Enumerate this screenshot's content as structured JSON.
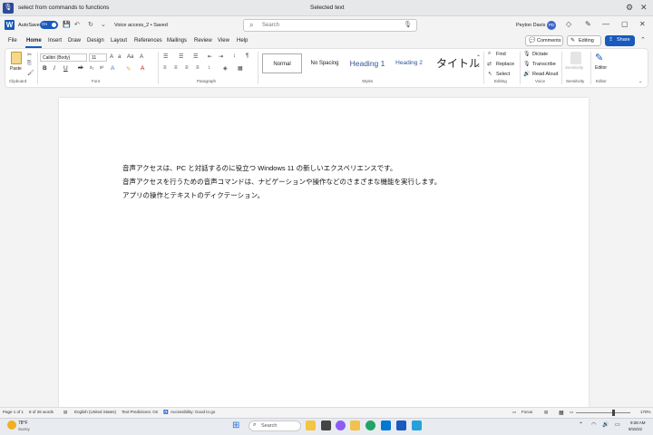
{
  "voice_access": {
    "command_text": "select from commands to functions",
    "title": "Selected text"
  },
  "titlebar": {
    "autosave_label": "AutoSave",
    "autosave_state": "On",
    "doc_name": "Voice access_2 • Saved",
    "search_placeholder": "Search",
    "user_name": "Peyton Davis",
    "user_initials": "PD"
  },
  "tabs": [
    "File",
    "Home",
    "Insert",
    "Draw",
    "Design",
    "Layout",
    "References",
    "Mailings",
    "Review",
    "View",
    "Help"
  ],
  "actions": {
    "comments": "Comments",
    "editing": "Editing",
    "share": "Share"
  },
  "ribbon": {
    "clipboard": {
      "label": "Clipboard",
      "paste": "Paste"
    },
    "font": {
      "label": "Font",
      "family": "Calibri (Body)",
      "size": "11"
    },
    "paragraph": {
      "label": "Paragraph"
    },
    "styles": {
      "label": "Styles",
      "items": [
        "Normal",
        "No Spacing",
        "Heading 1",
        "Heading 2",
        "タイトル"
      ]
    },
    "editing": {
      "label": "Editing",
      "find": "Find",
      "replace": "Replace",
      "select": "Select"
    },
    "voice": {
      "label": "Voice",
      "dictate": "Dictate",
      "transcribe": "Transcribe",
      "read_aloud": "Read Aloud"
    },
    "sensitivity": {
      "label": "Sensitivity",
      "button": "Sensitivity"
    },
    "editor": {
      "label": "Editor",
      "button": "Editor"
    }
  },
  "document": {
    "lines": [
      "音声アクセスは、PC と対話するのに役立つ Windows 11 の新しいエクスペリエンスです。",
      "音声アクセスを行うための音声コマンドは、ナビゲーションや操作などのさまざまな機能を実行します。",
      "アプリの操作とテキストのディクテーション。"
    ]
  },
  "status": {
    "page": "Page 1 of 1",
    "words": "8 of 26 words",
    "language": "English (United States)",
    "predictions": "Text Predictions: On",
    "accessibility": "Accessibility: Good to go",
    "focus": "Focus",
    "zoom": "170%"
  },
  "taskbar": {
    "temp": "78°F",
    "weather": "Sunny",
    "search": "Search",
    "time": "9:28 AM",
    "date": "9/15/22"
  },
  "colors": {
    "word_blue": "#185abd",
    "accent": "#3a66c9"
  }
}
